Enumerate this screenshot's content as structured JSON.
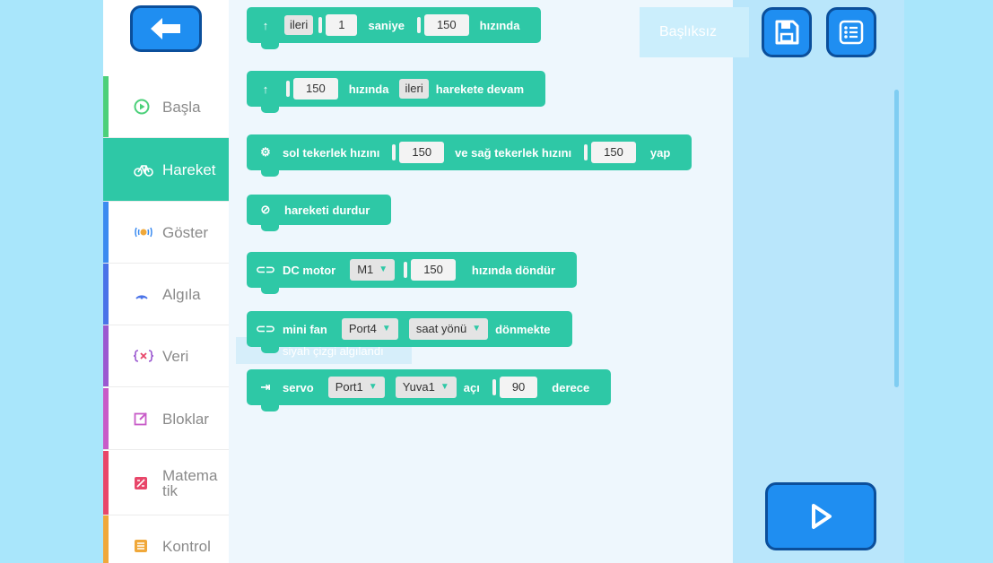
{
  "project": {
    "title": "Başlıksız"
  },
  "sidebar": {
    "categories": [
      {
        "label": "Başla",
        "icon": "play-circle-icon",
        "color": "#4cd07a"
      },
      {
        "label": "Hareket",
        "icon": "bicycle-icon",
        "color": "#2ec8a6",
        "active": true
      },
      {
        "label": "Göster",
        "icon": "light-icon",
        "color": "#3b8bf0"
      },
      {
        "label": "Algıla",
        "icon": "sensor-icon",
        "color": "#4a73e8"
      },
      {
        "label": "Veri",
        "icon": "variable-icon",
        "color": "#9b59d0"
      },
      {
        "label": "Bloklar",
        "icon": "edit-icon",
        "color": "#c85bc8"
      },
      {
        "label": "Matematik",
        "icon": "math-icon",
        "color": "#e8476a"
      },
      {
        "label": "Kontrol",
        "icon": "control-icon",
        "color": "#f0a83a"
      }
    ]
  },
  "blocks": {
    "forward_seconds": {
      "dir": "ileri",
      "seconds": "1",
      "t1": "saniye",
      "speed": "150",
      "t2": "hızında"
    },
    "continue_move": {
      "speed": "150",
      "t1": "hızında",
      "dir": "ileri",
      "t2": "harekete devam"
    },
    "wheel_speed": {
      "t1": "sol tekerlek hızını",
      "left": "150",
      "t2": "ve sağ tekerlek hızını",
      "right": "150",
      "t3": "yap"
    },
    "stop": {
      "t1": "hareketi durdur"
    },
    "dc_motor": {
      "t1": "DC motor",
      "motor": "M1",
      "speed": "150",
      "t2": "hızında döndür"
    },
    "mini_fan": {
      "t1": "mini fan",
      "port": "Port4",
      "direction": "saat yönü",
      "t2": "dönmekte"
    },
    "servo": {
      "t1": "servo",
      "port": "Port1",
      "slot": "Yuva1",
      "t2": "açı",
      "angle": "90",
      "t3": "derece"
    }
  },
  "ghost_block": {
    "label": "siyah çizgi algılandı"
  },
  "colors": {
    "motion": "#2ec8a6",
    "button": "#1f8ef1",
    "button_border": "#0b4f9b"
  }
}
